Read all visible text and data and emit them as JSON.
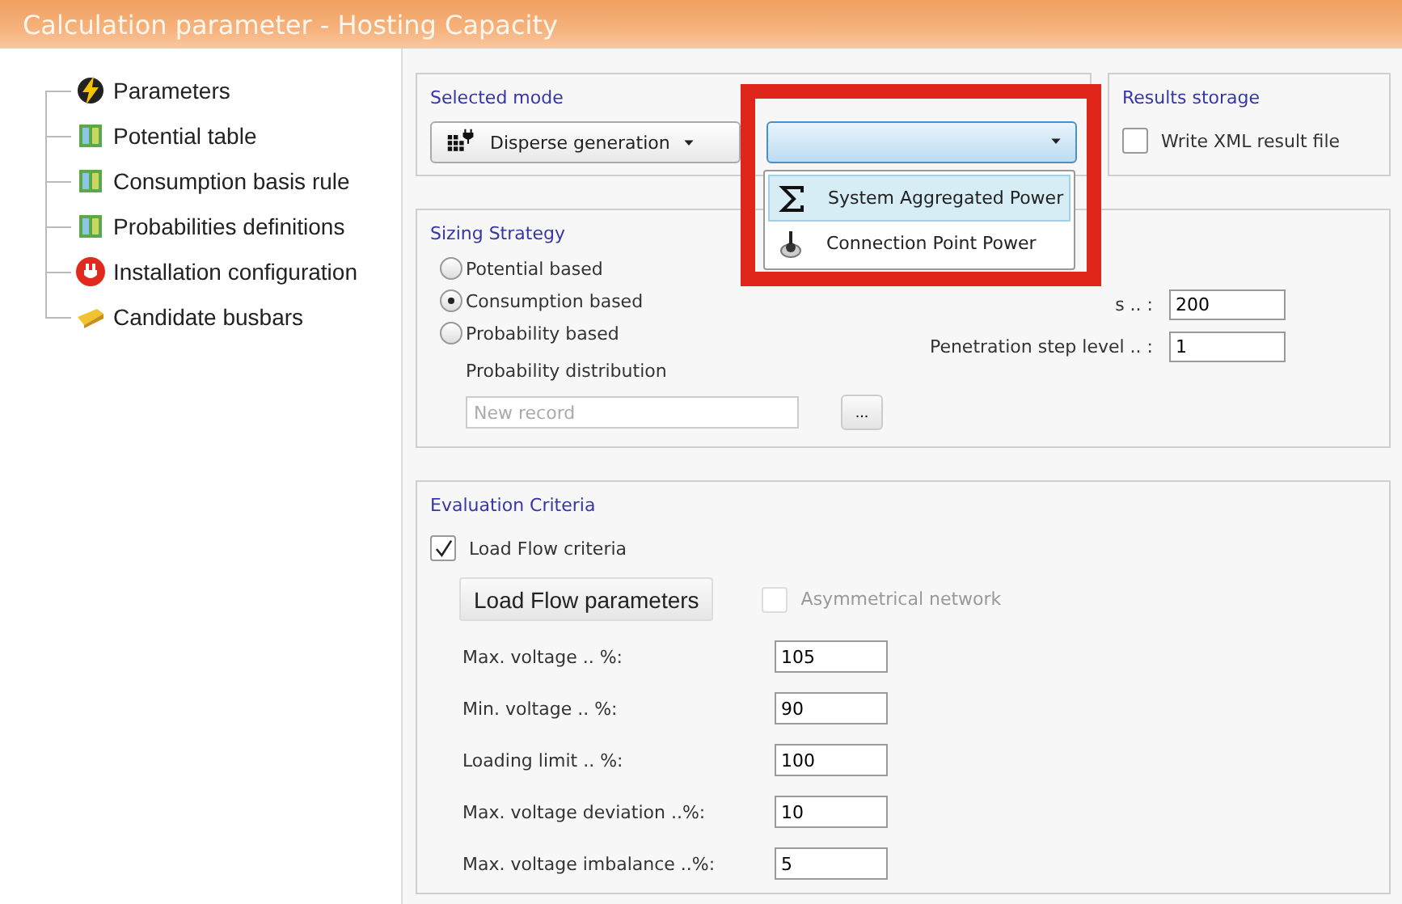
{
  "window": {
    "title": "Calculation parameter - Hosting Capacity"
  },
  "tree": {
    "items": [
      {
        "label": "Parameters",
        "kind": "lightning"
      },
      {
        "label": "Potential table",
        "kind": "table"
      },
      {
        "label": "Consumption basis rule",
        "kind": "table"
      },
      {
        "label": "Probabilities definitions",
        "kind": "table"
      },
      {
        "label": "Installation configuration",
        "kind": "plug"
      },
      {
        "label": "Candidate busbars",
        "kind": "busbar"
      }
    ]
  },
  "selected_mode": {
    "title": "Selected mode",
    "mode_combo": {
      "value": "Disperse generation"
    },
    "power_combo": {
      "expanded": true,
      "options": [
        {
          "label": "System Aggregated Power",
          "kind": "sum",
          "selected": true
        },
        {
          "label": "Connection Point Power",
          "kind": "connection",
          "selected": false
        }
      ]
    }
  },
  "results_storage": {
    "title": "Results storage",
    "write_xml": {
      "label": "Write XML result file",
      "checked": false
    }
  },
  "sizing_strategy": {
    "title": "Sizing Strategy",
    "options": [
      {
        "label": "Potential based",
        "selected": false
      },
      {
        "label": "Consumption based",
        "selected": true
      },
      {
        "label": "Probability based",
        "selected": false
      }
    ],
    "distribution": {
      "label": "Probability distribution",
      "placeholder": "New record",
      "browse": "..."
    },
    "fields": [
      {
        "label": "s .. :",
        "value": "200"
      },
      {
        "label": "Penetration step level .. :",
        "value": "1"
      }
    ]
  },
  "evaluation_criteria": {
    "title": "Evaluation Criteria",
    "load_flow": {
      "label": "Load Flow criteria",
      "checked": true
    },
    "parameters_button": "Load Flow parameters",
    "asymmetrical": {
      "label": "Asymmetrical network",
      "checked": false,
      "disabled": true
    },
    "fields": [
      {
        "label": "Max. voltage .. %:",
        "value": "105"
      },
      {
        "label": "Min. voltage .. %:",
        "value": "90"
      },
      {
        "label": "Loading limit .. %:",
        "value": "100"
      },
      {
        "label": "Max. voltage deviation ..%:",
        "value": "10"
      },
      {
        "label": "Max. voltage imbalance ..%:",
        "value": "5"
      }
    ]
  }
}
